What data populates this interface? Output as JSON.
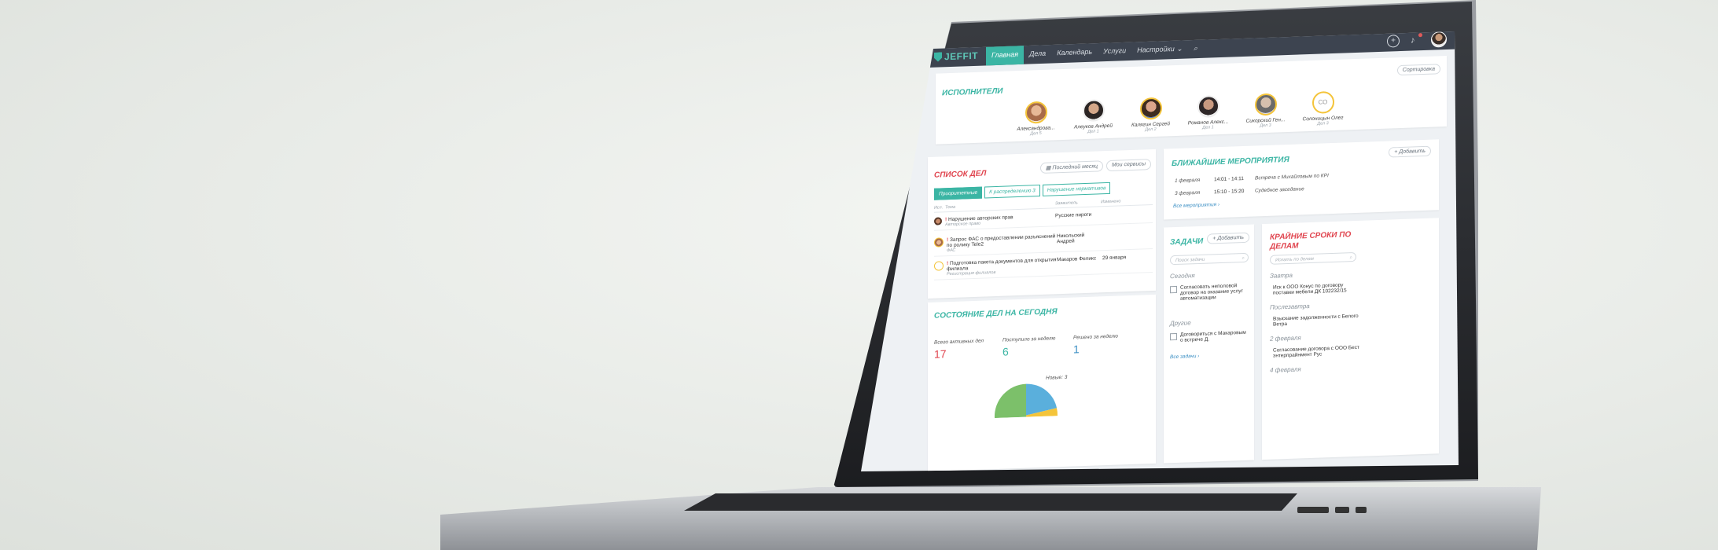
{
  "topbar": {
    "logo": "JEFFIT",
    "nav": [
      "Главная",
      "Дела",
      "Календарь",
      "Услуги",
      "Настройки ⌄"
    ],
    "search_icon": "search-icon",
    "add_icon": "plus-circle-icon",
    "bell_icon": "bell-icon"
  },
  "performers": {
    "title": "Исполнители",
    "sort_label": "Сортировка",
    "people": [
      {
        "name": "Александрова...",
        "sub": "Дел 5"
      },
      {
        "name": "Алеуков Андрей",
        "sub": "Дел 1"
      },
      {
        "name": "Калягин Сергей",
        "sub": "Дел 2"
      },
      {
        "name": "Романов Алекс...",
        "sub": "Дел 1"
      },
      {
        "name": "Сикорский Ген...",
        "sub": "Дел 3"
      },
      {
        "name": "Солоницын Олег",
        "sub": "Дел 3",
        "initials": "СО"
      }
    ]
  },
  "cases": {
    "title": "Список дел",
    "filter_month": "Последний месяц",
    "filter_services": "Мои сервисы",
    "tabs": [
      "Приоритетные",
      "К распределению 3",
      "Нарушение нормативов"
    ],
    "columns": [
      "Исп.",
      "Тема",
      "Заявитель",
      "Изменено"
    ],
    "rows": [
      {
        "subject": "Нарушение авторских прав",
        "category": "Авторское право",
        "applicant": "Русские пироги",
        "changed": ""
      },
      {
        "subject": "Запрос ФАС о предоставлении разъяснений по ролику Tele2",
        "category": "ФАС",
        "applicant": "Никольский Андрей",
        "changed": ""
      },
      {
        "subject": "Подготовка пакета документов для открытия филиала",
        "category": "Регистрация филиалов",
        "applicant": "Макаров Феликс",
        "changed": "29 января"
      }
    ]
  },
  "events": {
    "title": "Ближайшие мероприятия",
    "add_label": "Добавить",
    "items": [
      {
        "date": "1 февраля",
        "time": "14:01 - 14:11",
        "text": "Встреча с Михайловым по КРI"
      },
      {
        "date": "3 февраля",
        "time": "15:10 - 15:20",
        "text": "Судебное заседание"
      }
    ],
    "more": "Все мероприятия ›"
  },
  "status": {
    "title": "Состояние дел на сегодня",
    "stats": [
      {
        "label": "Всего активных дел",
        "value": "17"
      },
      {
        "label": "Поступило за неделю",
        "value": "6"
      },
      {
        "label": "Решено за неделю",
        "value": "1"
      }
    ],
    "pie_label": "Новые: 3"
  },
  "tasks": {
    "title": "Задачи",
    "add_label": "Добавить",
    "search_placeholder": "Поиск задачи",
    "today_label": "Сегодня",
    "today_items": [
      "Согласовать неполовой договор на оказание услуг автоматизации"
    ],
    "other_label": "Другие",
    "other_items": [
      "Договориться с Макаровым о встрече Д."
    ],
    "more": "Все задачи ›"
  },
  "deadlines": {
    "title": "Крайние сроки по делам",
    "search_placeholder": "Искать по делам",
    "groups": [
      {
        "label": "Завтра",
        "item": "Иск к ООО Конус по договору поставки мебели ДК 102232/15"
      },
      {
        "label": "Послезавтра",
        "item": "Взыскание задолженности с Белого Ветра"
      },
      {
        "label": "2 февраля",
        "item": "Согласование договора с ООО Бест энтерпрайнмент Рус"
      },
      {
        "label": "4 февраля",
        "item": ""
      }
    ]
  },
  "colors": {
    "accent": "#3bb5a4",
    "alert": "#e0454f",
    "link": "#3b8fc4",
    "topbar": "#3d4450"
  }
}
